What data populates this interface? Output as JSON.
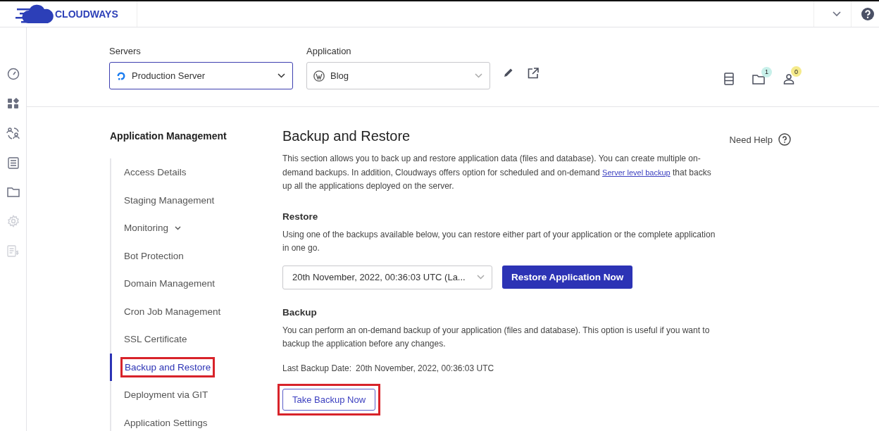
{
  "topbar": {
    "brand": "CLOUDWAYS"
  },
  "rail": [
    {
      "kind": "gauge",
      "disabled": false
    },
    {
      "kind": "apps",
      "disabled": false
    },
    {
      "kind": "team",
      "disabled": false
    },
    {
      "kind": "list",
      "disabled": false
    },
    {
      "kind": "folder",
      "disabled": false
    },
    {
      "kind": "gear",
      "disabled": true
    },
    {
      "kind": "billing",
      "disabled": true
    }
  ],
  "selectors": [
    {
      "label": "Servers",
      "value": "Production Server",
      "kind": "server",
      "focused": true
    },
    {
      "label": "Application",
      "value": "Blog",
      "kind": "wordpress",
      "focused": false
    }
  ],
  "header_icons": [
    {
      "kind": "server"
    },
    {
      "kind": "folder",
      "badge": {
        "text": "1",
        "color": "#c8f0ea"
      }
    },
    {
      "kind": "user",
      "badge": {
        "text": "0",
        "color": "#f5ea8a"
      }
    }
  ],
  "nav": {
    "title": "Application Management",
    "items": [
      {
        "label": "Access Details",
        "selected": false,
        "highlighted": false
      },
      {
        "label": "Staging Management",
        "selected": false,
        "highlighted": false
      },
      {
        "label": "Monitoring",
        "selected": false,
        "highlighted": false,
        "expanded": false
      },
      {
        "label": "Bot Protection",
        "selected": false,
        "highlighted": false
      },
      {
        "label": "Domain Management",
        "selected": false,
        "highlighted": false
      },
      {
        "label": "Cron Job Management",
        "selected": false,
        "highlighted": false
      },
      {
        "label": "SSL Certificate",
        "selected": false,
        "highlighted": false
      },
      {
        "label": "Backup and Restore",
        "selected": true,
        "highlighted": true
      },
      {
        "label": "Deployment via GIT",
        "selected": false,
        "highlighted": false
      },
      {
        "label": "Application Settings",
        "selected": false,
        "highlighted": false
      }
    ]
  },
  "content": {
    "title": "Backup and Restore",
    "help": "Need Help",
    "intro": {
      "before": "This section allows you to back up and restore application data (files and database). You can create multiple on-demand backups. In addition, Cloudways offers option for scheduled and on-demand ",
      "link": "Server level backup",
      "after": " that backs up all the applications deployed on the server."
    },
    "restore": {
      "heading": "Restore",
      "text": "Using one of the backups available below, you can restore either part of your application or the complete application in one go.",
      "select_value": "20th November, 2022, 00:36:03 UTC (La...",
      "button": "Restore Application Now"
    },
    "backup": {
      "heading": "Backup",
      "text": "You can perform an on-demand backup of your application (files and database). This option is useful if you want to backup the application before any changes.",
      "last_label": "Last Backup Date:",
      "last_value": "20th November, 2022, 00:36:03 UTC",
      "button": "Take Backup Now",
      "highlighted": true
    }
  }
}
